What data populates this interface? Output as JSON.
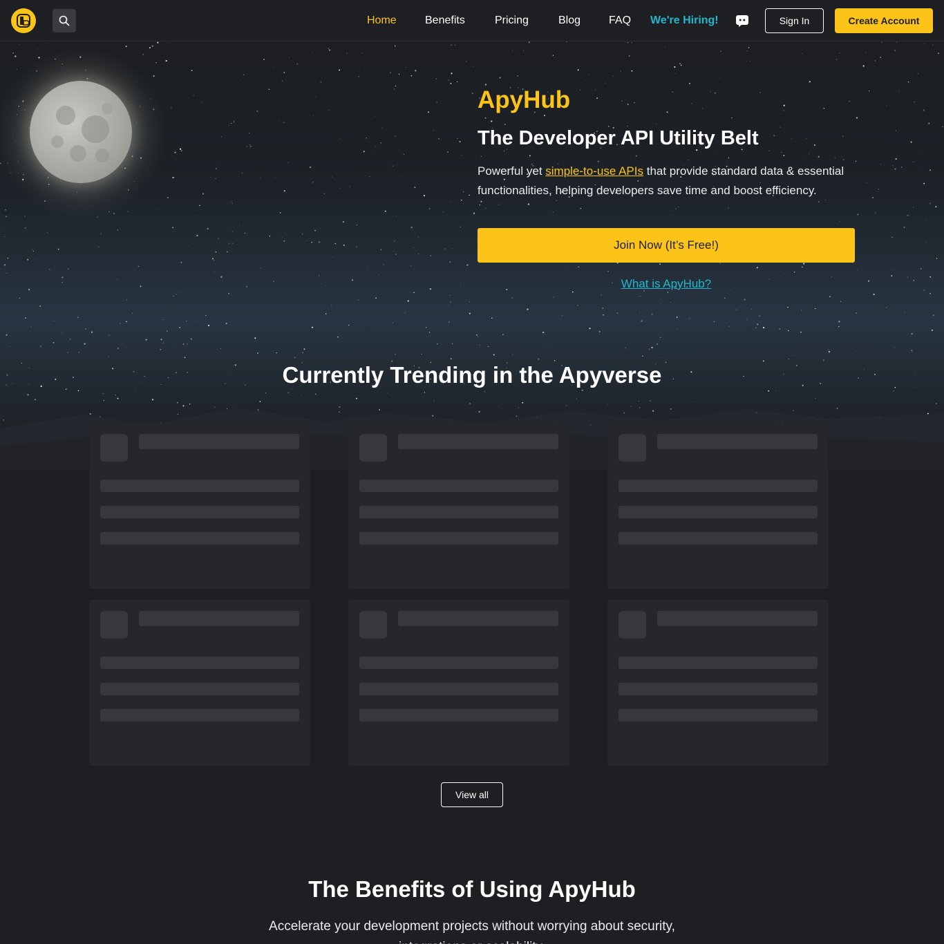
{
  "nav": {
    "links": [
      "Home",
      "Benefits",
      "Pricing",
      "Blog",
      "FAQ"
    ],
    "hiring": "We're Hiring!",
    "sign_in": "Sign In",
    "create_account": "Create Account"
  },
  "hero": {
    "brand": "ApyHub",
    "subtitle": "The Developer API Utility Belt",
    "desc_before": "Powerful yet ",
    "desc_link": "simple-to-use APIs",
    "desc_after": " that provide standard data & essential functionalities, helping developers save time and boost efficiency.",
    "join_button": "Join Now (It’s Free!)",
    "what_link": "What is ApyHub?"
  },
  "trending": {
    "title": "Currently Trending in the Apyverse",
    "view_all": "View all"
  },
  "benefits": {
    "title": "The Benefits of Using ApyHub",
    "description": "Accelerate your development projects without worrying about security, integrations or scalability."
  },
  "icons": {
    "logo": "apyhub-logo",
    "search": "search-icon",
    "discord": "discord-icon"
  },
  "colors": {
    "accent": "#fcc419",
    "link": "#22b8cf",
    "background": "#1e1f22",
    "card": "#26272b"
  }
}
